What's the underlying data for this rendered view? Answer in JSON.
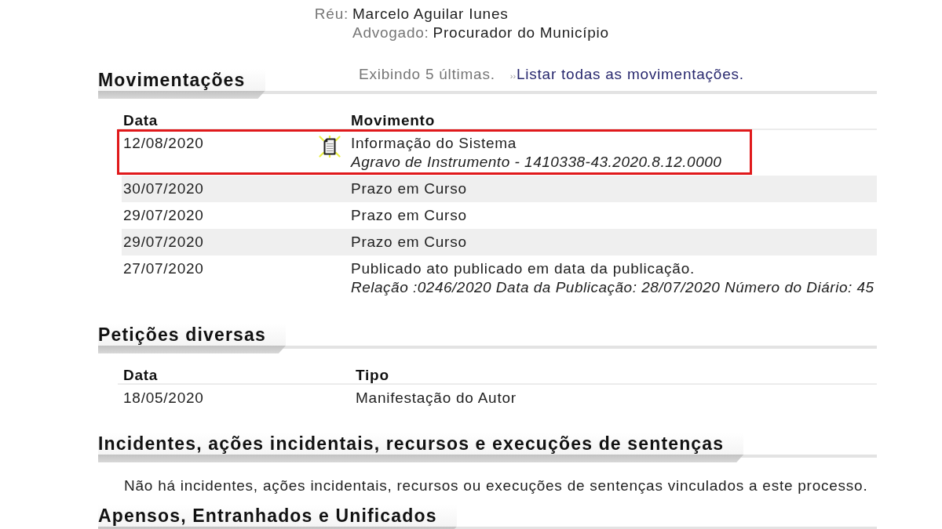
{
  "party": {
    "role_label": "Réu:",
    "name": "Marcelo Aguilar Iunes",
    "lawyer_label": "Advogado:",
    "lawyer_name": "Procurador do Município"
  },
  "sections": [
    {
      "kind": "movements",
      "title": "Movimentações",
      "note": "Exibindo 5 últimas.",
      "link_marker": "››",
      "link": "Listar todas as movimentações.",
      "columns": [
        "Data",
        "Movimento"
      ],
      "rows": [
        {
          "date": "12/08/2020",
          "has_document": true,
          "highlighted": true,
          "text": "Informação do Sistema",
          "detail": "Agravo de Instrumento - 1410338-43.2020.8.12.0000"
        },
        {
          "date": "30/07/2020",
          "has_document": false,
          "highlighted": false,
          "text": "Prazo em Curso"
        },
        {
          "date": "29/07/2020",
          "has_document": false,
          "highlighted": false,
          "text": "Prazo em Curso"
        },
        {
          "date": "29/07/2020",
          "has_document": false,
          "highlighted": false,
          "text": "Prazo em Curso"
        },
        {
          "date": "27/07/2020",
          "has_document": false,
          "highlighted": false,
          "text": "Publicado ato publicado em data da publicação.",
          "detail": "Relação :0246/2020 Data da Publicação: 28/07/2020 Número do Diário: 45"
        }
      ]
    },
    {
      "kind": "table",
      "title": "Petições diversas",
      "columns": [
        "Data",
        "Tipo"
      ],
      "rows": [
        {
          "date": "18/05/2020",
          "text": "Manifestação do Autor"
        }
      ]
    },
    {
      "kind": "message",
      "title": "Incidentes, ações incidentais, recursos e execuções de sentenças",
      "message": "Não há incidentes, ações incidentais, recursos ou execuções de sentenças vinculados a este processo."
    },
    {
      "kind": "heading",
      "title": "Apensos, Entranhados e Unificados"
    }
  ]
}
